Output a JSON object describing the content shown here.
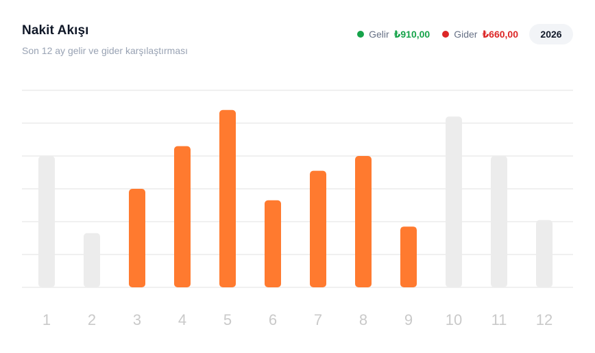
{
  "header": {
    "title": "Nakit Akışı",
    "subtitle": "Son 12 ay gelir ve gider karşılaştırması",
    "year": "2026"
  },
  "legend": [
    {
      "label": "Gelir",
      "value": "₺910,00",
      "color": "#16a34a"
    },
    {
      "label": "Gider",
      "value": "₺660,00",
      "color": "#dc2626"
    }
  ],
  "colors": {
    "active_bar": "#ff7a2f",
    "inactive_bar": "#ececec",
    "grid": "#f0f0f0",
    "tick_label": "#c9c9c9"
  },
  "chart_data": {
    "type": "bar",
    "categories": [
      "1",
      "2",
      "3",
      "4",
      "5",
      "6",
      "7",
      "8",
      "9",
      "10",
      "11",
      "12"
    ],
    "values": [
      40,
      16.5,
      30,
      43,
      54,
      26.5,
      35.5,
      40,
      18.5,
      52,
      40,
      20.5
    ],
    "active": [
      false,
      false,
      true,
      true,
      true,
      true,
      true,
      true,
      true,
      false,
      false,
      false
    ],
    "ylim": [
      0,
      60
    ],
    "grid": true
  }
}
